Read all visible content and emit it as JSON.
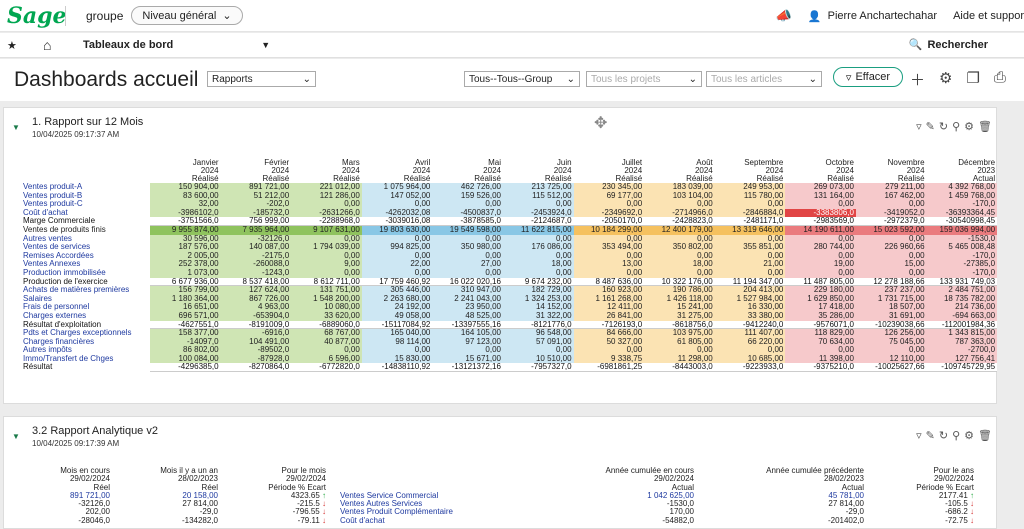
{
  "topbar": {
    "logo": "Sage",
    "group_label": "groupe",
    "group_value": "Niveau général",
    "user": "Pierre Anchartechahar",
    "help": "Aide et suppor"
  },
  "navbar": {
    "dashboard_label": "Tableaux de bord",
    "search_label": "Rechercher"
  },
  "page": {
    "title": "Dashboards accueil",
    "dashboard_select": "Rapports",
    "group_filter": "Tous--Tous--Group",
    "projects_placeholder": "Tous les projets",
    "articles_placeholder": "Tous les articles",
    "clear_label": "Effacer"
  },
  "panel1": {
    "title": "1. Rapport sur 12 Mois",
    "date": "10/04/2025 09:17:37 AM",
    "columns": [
      {
        "m": "Janvier",
        "y": "2024",
        "t": "Réalisé"
      },
      {
        "m": "Février",
        "y": "2024",
        "t": "Réalisé"
      },
      {
        "m": "Mars",
        "y": "2024",
        "t": "Réalisé"
      },
      {
        "m": "Avril",
        "y": "2024",
        "t": "Réalisé"
      },
      {
        "m": "Mai",
        "y": "2024",
        "t": "Réalisé"
      },
      {
        "m": "Juin",
        "y": "2024",
        "t": "Réalisé"
      },
      {
        "m": "Juillet",
        "y": "2024",
        "t": "Réalisé"
      },
      {
        "m": "Août",
        "y": "2024",
        "t": "Réalisé"
      },
      {
        "m": "Septembre",
        "y": "2024",
        "t": "Réalisé"
      },
      {
        "m": "Octobre",
        "y": "2024",
        "t": "Réalisé"
      },
      {
        "m": "Novembre",
        "y": "2024",
        "t": "Réalisé"
      },
      {
        "m": "Décembre",
        "y": "2023",
        "t": "Actual"
      }
    ],
    "rows": [
      {
        "label": "Ventes produit-A",
        "kind": "blue",
        "v": [
          "150 904,00",
          "891 721,00",
          "221 012,00",
          "1 075 964,00",
          "462 726,00",
          "213 725,00",
          "230 345,00",
          "183 039,00",
          "249 953,00",
          "269 073,00",
          "279 211,00",
          "4 392 768,00"
        ]
      },
      {
        "label": "Ventes produit-B",
        "kind": "blue",
        "v": [
          "83 600,00",
          "51 212,00",
          "121 286,00",
          "147 052,00",
          "159 526,00",
          "115 512,00",
          "69 177,00",
          "103 104,00",
          "115 780,00",
          "131 164,00",
          "167 462,00",
          "1 459 768,00"
        ]
      },
      {
        "label": "Ventes produit-C",
        "kind": "blue",
        "v": [
          "32,00",
          "-202,0",
          "0,00",
          "0,00",
          "0,00",
          "0,00",
          "0,00",
          "0,00",
          "0,00",
          "0,00",
          "0,00",
          "-170,0"
        ]
      },
      {
        "label": "Coût d'achat",
        "kind": "blue",
        "v": [
          "-3986102,0",
          "-185732,0",
          "-2631266,0",
          "-4262032,08",
          "-4500837,0",
          "-2453924,0",
          "-2349692,0",
          "-2714966,0",
          "-2846884,0",
          "-3383806,0",
          "-3419052,0",
          "-36393364,45"
        ]
      },
      {
        "label": "Marge Commerciale",
        "kind": "bold",
        "v": [
          "-3751566,0",
          "756 999,00",
          "-2288968,0",
          "-3039016,08",
          "-3878585,0",
          "-2124687,0",
          "-2050170,0",
          "-2428823,0",
          "-2481171,0",
          "-2983569,0",
          "-2972379,0",
          "-30540998,45"
        ]
      },
      {
        "label": "Ventes de produits finis",
        "kind": "hl",
        "v": [
          "9 955 874,00",
          "7 935 964,00",
          "9 107 631,00",
          "19 803 630,00",
          "19 549 598,00",
          "11 622 815,00",
          "10 184 299,00",
          "12 400 179,00",
          "13 319 646,00",
          "14 190 611,00",
          "15 023 592,00",
          "159 036 994,00"
        ]
      },
      {
        "label": "Autres ventes",
        "kind": "blue",
        "v": [
          "30 596,00",
          "-32126,0",
          "0,00",
          "0,00",
          "0,00",
          "0,00",
          "0,00",
          "0,00",
          "0,00",
          "0,00",
          "0,00",
          "-1530,0"
        ]
      },
      {
        "label": "Ventes de services",
        "kind": "blue",
        "v": [
          "187 576,00",
          "140 087,00",
          "1 794 039,00",
          "994 825,00",
          "350 980,00",
          "176 086,00",
          "353 494,00",
          "350 802,00",
          "355 851,00",
          "280 744,00",
          "226 960,66",
          "5 465 008,48"
        ]
      },
      {
        "label": "Remises Accordées",
        "kind": "blue",
        "v": [
          "2 005,00",
          "-2175,0",
          "0,00",
          "0,00",
          "0,00",
          "0,00",
          "0,00",
          "0,00",
          "0,00",
          "0,00",
          "0,00",
          "-170,0"
        ]
      },
      {
        "label": "Ventes Annexes",
        "kind": "blue",
        "v": [
          "252 378,00",
          "-260088,0",
          "9,00",
          "22,00",
          "27,00",
          "18,00",
          "13,00",
          "18,00",
          "21,00",
          "19,00",
          "15,00",
          "-27385,0"
        ]
      },
      {
        "label": "Production immobilisée",
        "kind": "blue",
        "v": [
          "1 073,00",
          "-1243,0",
          "0,00",
          "0,00",
          "0,00",
          "0,00",
          "0,00",
          "0,00",
          "0,00",
          "0,00",
          "0,00",
          "-170,0"
        ]
      },
      {
        "label": "Production de l'exercice",
        "kind": "bold",
        "v": [
          "6 677 936,00",
          "8 537 418,00",
          "8 612 711,00",
          "17 759 460,92",
          "16 022 020,16",
          "9 674 232,00",
          "8 487 636,00",
          "10 322 176,00",
          "11 194 347,00",
          "11 487 805,00",
          "12 278 188,66",
          "133 931 749,03"
        ]
      },
      {
        "label": "Achats de matières premières",
        "kind": "blue",
        "v": [
          "156 799,00",
          "127 624,00",
          "131 751,00",
          "305 446,00",
          "310 947,00",
          "182 729,00",
          "160 923,00",
          "190 786,00",
          "204 413,00",
          "229 180,00",
          "237 237,00",
          "2 484 751,00"
        ]
      },
      {
        "label": "Salaires",
        "kind": "blue",
        "v": [
          "1 180 364,00",
          "867 726,00",
          "1 548 200,00",
          "2 263 680,00",
          "2 241 043,00",
          "1 324 253,00",
          "1 161 268,00",
          "1 426 118,00",
          "1 527 984,00",
          "1 629 850,00",
          "1 731 715,00",
          "18 735 782,00"
        ]
      },
      {
        "label": "Frais de personnel",
        "kind": "blue",
        "v": [
          "16 651,00",
          "4 963,00",
          "10 080,00",
          "24 192,00",
          "23 950,00",
          "14 152,00",
          "12 411,00",
          "15 241,00",
          "16 330,00",
          "17 418,00",
          "18 507,00",
          "214 736,00"
        ]
      },
      {
        "label": "Charges externes",
        "kind": "blue",
        "v": [
          "696 571,00",
          "-653904,0",
          "33 620,00",
          "49 058,00",
          "48 525,00",
          "31 322,00",
          "26 841,00",
          "31 275,00",
          "33 380,00",
          "35 286,00",
          "31 691,00",
          "-694 663,00"
        ]
      },
      {
        "label": "Résultat d'exploitation",
        "kind": "bold",
        "v": [
          "-4627551,0",
          "-8191009,0",
          "-6889060,0",
          "-15117084,92",
          "-13397555,16",
          "-8121776,0",
          "-7126193,0",
          "-8618756,0",
          "-9412240,0",
          "-9576071,0",
          "-10239038,66",
          "-112001984,36"
        ]
      },
      {
        "label": "Pdts et Charges exceptionnels",
        "kind": "blue",
        "v": [
          "158 377,00",
          "-6916,0",
          "68 767,00",
          "165 040,00",
          "164 105,00",
          "96 548,00",
          "84 666,00",
          "103 975,00",
          "111 407,00",
          "118 829,00",
          "126 256,00",
          "1 343 815,00"
        ]
      },
      {
        "label": "Charges financières",
        "kind": "blue",
        "v": [
          "-14097,0",
          "104 491,00",
          "40 877,00",
          "98 114,00",
          "97 123,00",
          "57 091,00",
          "50 327,00",
          "61 805,00",
          "66 220,00",
          "70 634,00",
          "75 045,00",
          "787 363,00"
        ]
      },
      {
        "label": "Autres impôts",
        "kind": "blue",
        "v": [
          "86 802,00",
          "-89502,0",
          "0,00",
          "0,00",
          "0,00",
          "0,00",
          "0,00",
          "0,00",
          "0,00",
          "0,00",
          "0,00",
          "-2700,0"
        ]
      },
      {
        "label": "Immo/Transfert de Chges",
        "kind": "blue",
        "v": [
          "100 084,00",
          "-87928,0",
          "6 596,00",
          "15 830,00",
          "15 671,00",
          "10 510,00",
          "9 338,75",
          "11 298,00",
          "10 685,00",
          "11 398,00",
          "12 110,00",
          "127 756,41"
        ]
      },
      {
        "label": "Résultat",
        "kind": "bold",
        "v": [
          "-4296385,0",
          "-8270864,0",
          "-6772820,0",
          "-14838110,92",
          "-13121372,16",
          "-7957327,0",
          "-6981861,25",
          "-8443003,0",
          "-9223933,0",
          "-9375210,0",
          "-10025627,66",
          "-109745729,95"
        ]
      }
    ]
  },
  "panel2": {
    "title": "3.2 Rapport Analytique v2",
    "date": "10/04/2025 09:17:39 AM",
    "headers": [
      [
        "Mois en cours",
        "29/02/2024",
        "Réel"
      ],
      [
        "Mois il y a un an",
        "28/02/2023",
        "Réel"
      ],
      [
        "Pour le mois",
        "29/02/2024",
        "Période % Écart"
      ],
      [
        "Année cumulée en cours",
        "29/02/2024",
        "Actual"
      ],
      [
        "Année cumulée précédente",
        "28/02/2023",
        "Actual"
      ],
      [
        "Pour le ans",
        "29/02/2024",
        "Période % Écart"
      ]
    ],
    "rows": [
      {
        "a": "891 721,00",
        "b": "20 158,00",
        "c": "4323.65",
        "cu": true,
        "label": "Ventes Service Commercial",
        "d": "1 042 625,00",
        "e": "45 781,00",
        "f": "2177.41",
        "fu": true
      },
      {
        "a": "-32126,0",
        "b": "27 814,00",
        "c": "-215.5",
        "cu": false,
        "label": "Ventes Autres Services",
        "d": "-1530,0",
        "e": "27 814,00",
        "f": "-105.5",
        "fu": false
      },
      {
        "a": "202,00",
        "b": "-29,0",
        "c": "-796.55",
        "cu": false,
        "label": "Ventes Produit Complémentaire",
        "d": "170,00",
        "e": "-29,0",
        "f": "-686.2",
        "fu": false
      },
      {
        "a": "-28046,0",
        "b": "-134282,0",
        "c": "-79.11",
        "cu": false,
        "label": "Coût d'achat",
        "d": "-54882,0",
        "e": "-201402,0",
        "f": "-72.75",
        "fu": false
      }
    ]
  }
}
